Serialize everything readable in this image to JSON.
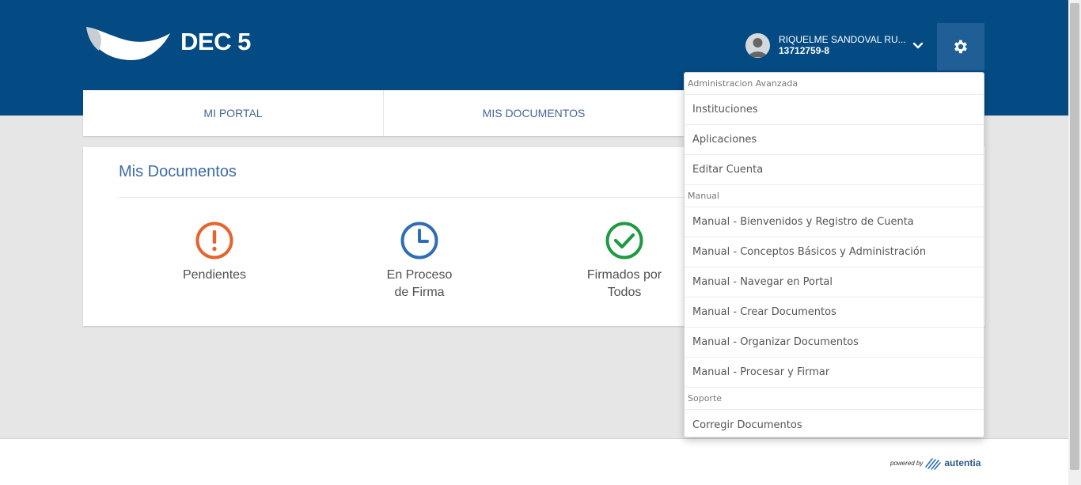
{
  "header": {
    "logo_text": "DEC 5",
    "user": {
      "name": "RIQUELME SANDOVAL RU...",
      "id": "13712759-8"
    },
    "colors": {
      "brand": "#044b84",
      "settings_bg": "#1f5f95"
    }
  },
  "nav": {
    "tabs": [
      {
        "label": "MI PORTAL"
      },
      {
        "label": "MIS DOCUMENTOS"
      }
    ]
  },
  "main": {
    "title": "Mis Documentos",
    "stats": [
      {
        "line1": "Pendientes",
        "line2": "",
        "icon": "exclamation-circle-icon",
        "color": "#e8622c"
      },
      {
        "line1": "En Proceso",
        "line2": "de Firma",
        "icon": "clock-icon",
        "color": "#2f6db8"
      },
      {
        "line1": "Firmados por",
        "line2": "Todos",
        "icon": "check-circle-icon",
        "color": "#1e9a41"
      }
    ]
  },
  "dropdown": {
    "sections": [
      {
        "header": "Administracion Avanzada",
        "items": [
          "Instituciones",
          "Aplicaciones",
          "Editar Cuenta"
        ]
      },
      {
        "header": "Manual",
        "items": [
          "Manual - Bienvenidos y Registro de Cuenta",
          "Manual - Conceptos Básicos y Administración",
          "Manual - Navegar en Portal",
          "Manual - Crear Documentos",
          "Manual - Organizar Documentos",
          "Manual - Procesar y Firmar"
        ]
      },
      {
        "header": "Soporte",
        "items": [
          "Corregir Documentos"
        ]
      }
    ]
  },
  "footer": {
    "powered_by": "powered by",
    "brand": "autentia"
  }
}
